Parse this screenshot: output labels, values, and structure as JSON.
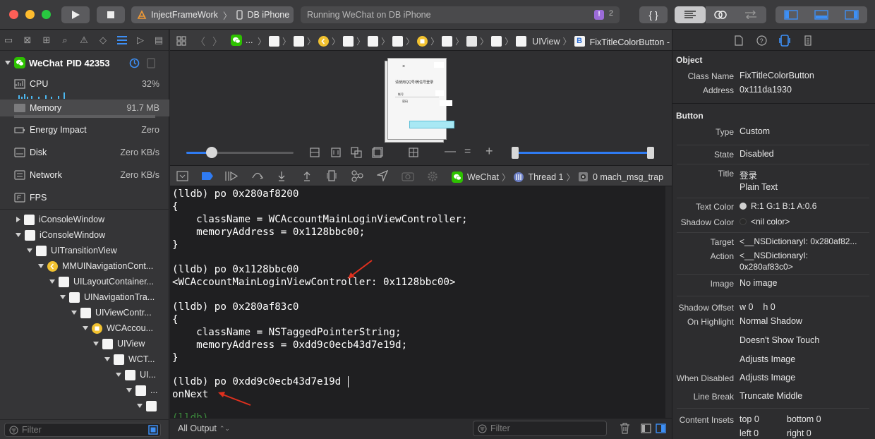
{
  "toolbar": {
    "scheme_target": "InjectFrameWork",
    "scheme_device": "DB iPhone",
    "status_text": "Running WeChat on DB iPhone",
    "issue_count": "2",
    "issue_badge": "!"
  },
  "navigator": {
    "process": {
      "name": "WeChat",
      "pid": "PID 42353"
    },
    "gauges": [
      {
        "label": "CPU",
        "value": "32%"
      },
      {
        "label": "Memory",
        "value": "91.7 MB"
      },
      {
        "label": "Energy Impact",
        "value": "Zero"
      },
      {
        "label": "Disk",
        "value": "Zero KB/s"
      },
      {
        "label": "Network",
        "value": "Zero KB/s"
      },
      {
        "label": "FPS",
        "value": ""
      }
    ],
    "tree": [
      {
        "label": "iConsoleWindow"
      },
      {
        "label": "iConsoleWindow"
      },
      {
        "label": "UITransitionView"
      },
      {
        "label": "MMUINavigationCont..."
      },
      {
        "label": "UILayoutContainer..."
      },
      {
        "label": "UINavigationTra..."
      },
      {
        "label": "UIViewContr..."
      },
      {
        "label": "WCAccou..."
      },
      {
        "label": "UIView"
      },
      {
        "label": "WCT..."
      },
      {
        "label": "UI..."
      },
      {
        "label": "..."
      },
      {
        "label": ""
      }
    ],
    "filter_placeholder": "Filter"
  },
  "jumpbar": {
    "app": "...",
    "uiview": "UIView",
    "button": "FixTitleColorButton - 登录",
    "class_badge": "B"
  },
  "canvas": {
    "preview_title": "请使用QQ号/微信号登录",
    "preview_field1": "帐号",
    "preview_field2": "密码"
  },
  "debugbar": {
    "app": "WeChat",
    "thread": "Thread 1",
    "frame": "0 mach_msg_trap"
  },
  "console": {
    "lines": [
      "(lldb) po 0x280af8200",
      "{",
      "    className = WCAccountMainLoginViewController;",
      "    memoryAddress = 0x1128bbc00;",
      "}",
      "",
      "(lldb) po 0x1128bbc00",
      "<WCAccountMainLoginViewController: 0x1128bbc00>",
      "",
      "(lldb) po 0x280af83c0",
      "{",
      "    className = NSTaggedPointerString;",
      "    memoryAddress = 0xdd9c0ecb43d7e19d;",
      "}",
      "",
      "(lldb) po 0xdd9c0ecb43d7e19d",
      "onNext",
      "",
      "(lldb)"
    ],
    "output_selector": "All Output",
    "filter_placeholder": "Filter"
  },
  "inspector": {
    "object_header": "Object",
    "class_name_label": "Class Name",
    "class_name": "FixTitleColorButton",
    "address_label": "Address",
    "address": "0x111da1930",
    "button_header": "Button",
    "type_label": "Type",
    "type": "Custom",
    "state_label": "State",
    "state": "Disabled",
    "title_label": "Title",
    "title": "登录",
    "title_kind": "Plain Text",
    "text_color_label": "Text Color",
    "text_color": "R:1 G:1 B:1 A:0.6",
    "shadow_color_label": "Shadow Color",
    "shadow_color": "<nil color>",
    "target_label": "Target",
    "target": "<__NSDictionaryI: 0x280af82...",
    "action_label": "Action",
    "action_line1": "<__NSDictionaryI:",
    "action_line2": "0x280af83c0>",
    "image_label": "Image",
    "image": "No image",
    "shadow_offset_label": "Shadow Offset",
    "shadow_offset": "w 0    h 0",
    "on_highlight_label": "On Highlight",
    "on_highlight": "Normal Shadow",
    "doesnt_show_touch": "Doesn't Show Touch",
    "adjusts_image_1": "Adjusts Image",
    "when_disabled_label": "When Disabled",
    "adjusts_image_2": "Adjusts Image",
    "line_break_label": "Line Break",
    "line_break": "Truncate Middle",
    "content_insets_label": "Content Insets",
    "inset_top": "top 0",
    "inset_bottom": "bottom 0",
    "inset_left": "left 0",
    "inset_right": "right 0"
  },
  "colors": {
    "accent": "#2f7bf2",
    "wechat_green": "#2dc100",
    "close": "#fe5f57",
    "minimize": "#febc2e",
    "zoom": "#28c840",
    "arrow_red": "#e0301e"
  }
}
